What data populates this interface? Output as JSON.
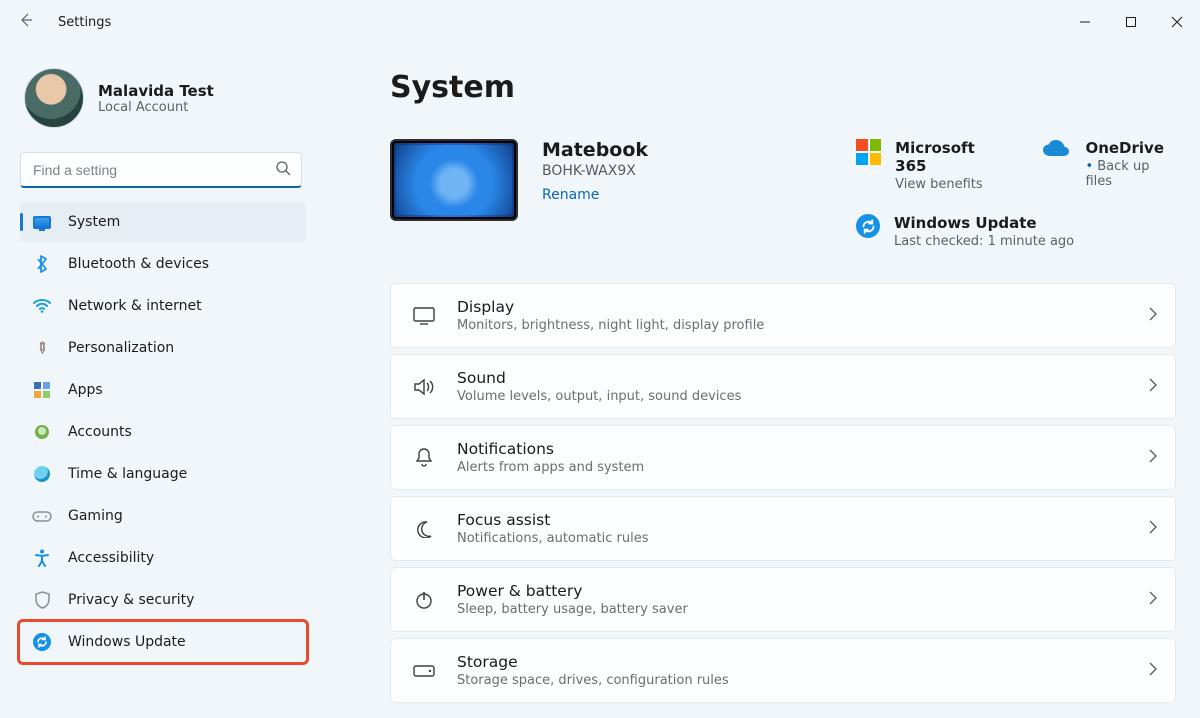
{
  "app": {
    "title": "Settings"
  },
  "user": {
    "name": "Malavida Test",
    "subtitle": "Local Account"
  },
  "search": {
    "placeholder": "Find a setting"
  },
  "sidebar": {
    "items": [
      {
        "label": "System"
      },
      {
        "label": "Bluetooth & devices"
      },
      {
        "label": "Network & internet"
      },
      {
        "label": "Personalization"
      },
      {
        "label": "Apps"
      },
      {
        "label": "Accounts"
      },
      {
        "label": "Time & language"
      },
      {
        "label": "Gaming"
      },
      {
        "label": "Accessibility"
      },
      {
        "label": "Privacy & security"
      },
      {
        "label": "Windows Update"
      }
    ]
  },
  "main": {
    "title": "System",
    "device": {
      "name": "Matebook",
      "model": "BOHK-WAX9X",
      "rename": "Rename"
    },
    "promos": {
      "ms365": {
        "title": "Microsoft 365",
        "sub": "View benefits"
      },
      "onedrive": {
        "title": "OneDrive",
        "sub": "Back up files"
      },
      "update": {
        "title": "Windows Update",
        "sub": "Last checked: 1 minute ago"
      }
    },
    "rows": [
      {
        "title": "Display",
        "sub": "Monitors, brightness, night light, display profile"
      },
      {
        "title": "Sound",
        "sub": "Volume levels, output, input, sound devices"
      },
      {
        "title": "Notifications",
        "sub": "Alerts from apps and system"
      },
      {
        "title": "Focus assist",
        "sub": "Notifications, automatic rules"
      },
      {
        "title": "Power & battery",
        "sub": "Sleep, battery usage, battery saver"
      },
      {
        "title": "Storage",
        "sub": "Storage space, drives, configuration rules"
      }
    ]
  }
}
